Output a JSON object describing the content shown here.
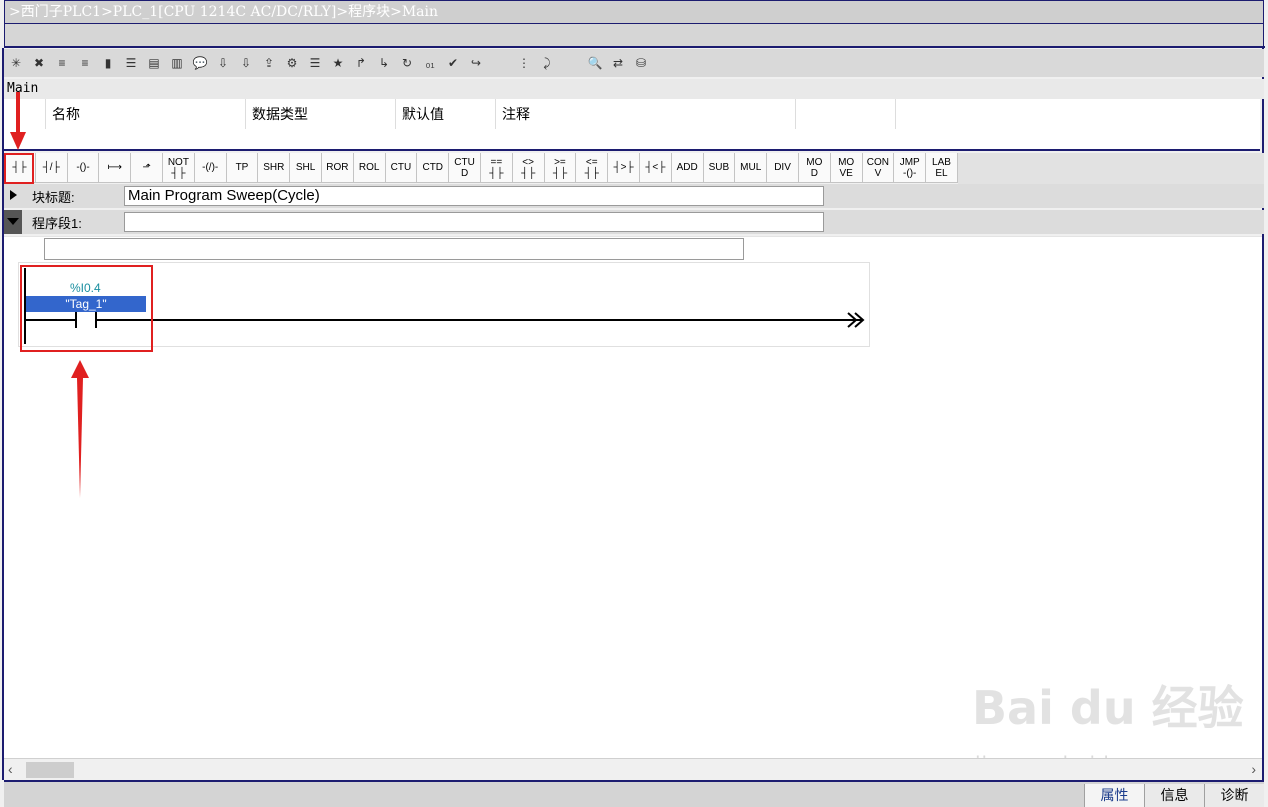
{
  "title_bar": {
    "path": ">西门子PLC1>PLC_1[CPU 1214C AC/DC/RLY]>程序块>Main"
  },
  "block_name": "Main",
  "interface": {
    "columns": [
      "",
      "名称",
      "数据类型",
      "默认值",
      "注释",
      ""
    ]
  },
  "palette": [
    {
      "name": "no-contact",
      "lines": [
        "┤├"
      ]
    },
    {
      "name": "nc-contact",
      "lines": [
        "┤/├"
      ]
    },
    {
      "name": "coil",
      "lines": [
        "-()-"
      ]
    },
    {
      "name": "branch-open",
      "lines": [
        "⟼"
      ]
    },
    {
      "name": "branch-close",
      "lines": [
        "⬏"
      ]
    },
    {
      "name": "not-contact",
      "lines": [
        "NOT",
        "┤├"
      ]
    },
    {
      "name": "negated-coil",
      "lines": [
        "-(/)-"
      ]
    },
    {
      "name": "tp",
      "lines": [
        "TP"
      ]
    },
    {
      "name": "shr",
      "lines": [
        "SHR"
      ]
    },
    {
      "name": "shl",
      "lines": [
        "SHL"
      ]
    },
    {
      "name": "ror",
      "lines": [
        "ROR"
      ]
    },
    {
      "name": "rol",
      "lines": [
        "ROL"
      ]
    },
    {
      "name": "ctu",
      "lines": [
        "CTU"
      ]
    },
    {
      "name": "ctd",
      "lines": [
        "CTD"
      ]
    },
    {
      "name": "ctud",
      "lines": [
        "CTU",
        "D"
      ]
    },
    {
      "name": "cmp-eq",
      "lines": [
        "==",
        "┤├"
      ]
    },
    {
      "name": "cmp-ne",
      "lines": [
        "<>",
        "┤├"
      ]
    },
    {
      "name": "cmp-ge",
      "lines": [
        ">=",
        "┤├"
      ]
    },
    {
      "name": "cmp-le",
      "lines": [
        "<=",
        "┤├"
      ]
    },
    {
      "name": "cmp-gt",
      "lines": [
        "┤>├"
      ]
    },
    {
      "name": "cmp-lt",
      "lines": [
        "┤<├"
      ]
    },
    {
      "name": "add",
      "lines": [
        "ADD"
      ]
    },
    {
      "name": "sub",
      "lines": [
        "SUB"
      ]
    },
    {
      "name": "mul",
      "lines": [
        "MUL"
      ]
    },
    {
      "name": "div",
      "lines": [
        "DIV"
      ]
    },
    {
      "name": "mod",
      "lines": [
        "MO",
        "D"
      ]
    },
    {
      "name": "move",
      "lines": [
        "MO",
        "VE"
      ]
    },
    {
      "name": "conv",
      "lines": [
        "CON",
        "V"
      ]
    },
    {
      "name": "jmp",
      "lines": [
        "JMP",
        "-()-"
      ]
    },
    {
      "name": "label",
      "lines": [
        "LAB",
        "EL"
      ]
    }
  ],
  "block_title": {
    "label": "块标题:",
    "value": "Main Program Sweep(Cycle)"
  },
  "network1": {
    "label": "程序段1:",
    "value": ""
  },
  "contact": {
    "address": "%I0.4",
    "tag": "\"Tag_1\""
  },
  "status_tabs": [
    "属性",
    "信息",
    "诊断"
  ],
  "watermark": {
    "main": "Bai du 经验",
    "sub": "jingyan.baidu.com"
  },
  "icons": [
    "insert-network-icon",
    "delete-network-icon",
    "insert-row-icon",
    "add-row-icon",
    "delete-row-icon",
    "view-icon",
    "expand-icon",
    "collapse-icon",
    "comment-icon",
    "monitor-icon",
    "download-icon",
    "upload-icon",
    "compile-icon",
    "list-icon",
    "favorite-icon",
    "open-branch-icon",
    "close-branch-icon",
    "refresh-icon",
    "value-icon",
    "check-icon",
    "go-icon",
    "indent-icon",
    "jump-icon",
    "search-icon",
    "link-icon",
    "db-icon"
  ]
}
